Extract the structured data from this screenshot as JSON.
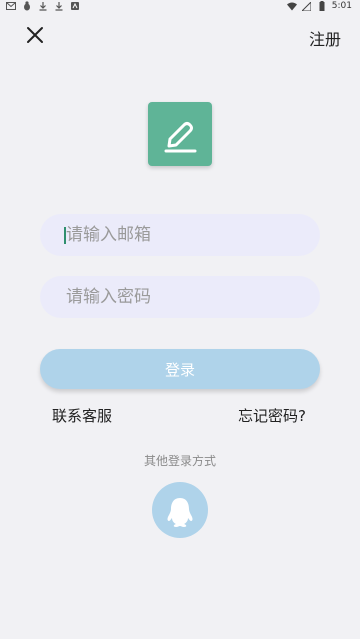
{
  "status_bar": {
    "time": "5:01",
    "left_icons": [
      "mail-icon",
      "bug-icon",
      "download-icon",
      "download-icon",
      "app-icon"
    ],
    "right_icons": [
      "wifi-icon",
      "signal-icon",
      "battery-icon"
    ]
  },
  "header": {
    "register_label": "注册"
  },
  "form": {
    "email_placeholder": "请输入邮箱",
    "password_placeholder": "请输入密码",
    "login_label": "登录"
  },
  "links": {
    "contact_support": "联系客服",
    "forgot_password": "忘记密码?"
  },
  "other_login": {
    "label": "其他登录方式",
    "qq_icon": "qq-penguin-icon"
  },
  "colors": {
    "logo_bg": "#5fb497",
    "field_bg": "#ebebfa",
    "login_btn_bg": "#afd3ea",
    "page_bg": "#f1f1f4"
  }
}
